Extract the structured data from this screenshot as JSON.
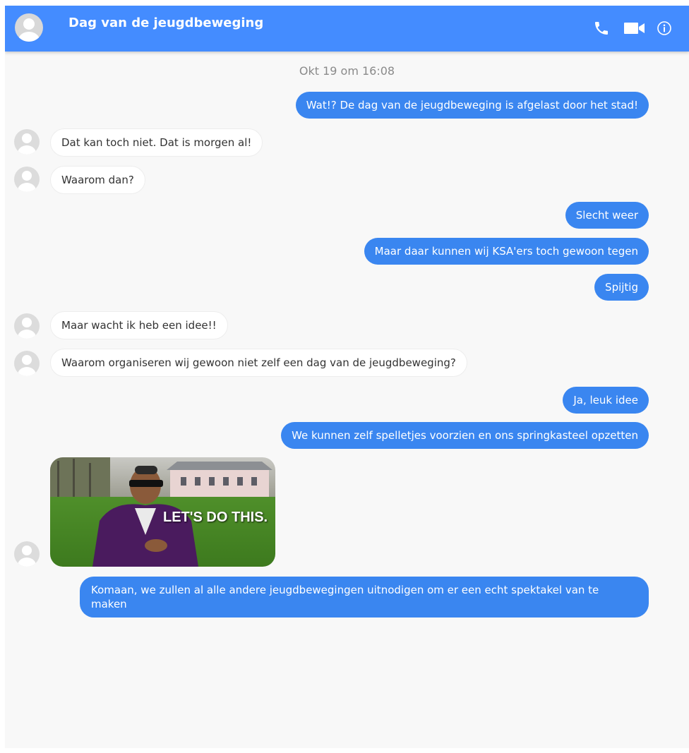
{
  "header": {
    "title": "Dag van de jeugdbeweging",
    "background_color": "#448cff",
    "icons": [
      "phone-icon",
      "video-camera-icon",
      "info-icon"
    ]
  },
  "thread": {
    "timestamp": "Okt 19 om 16:08",
    "messages": [
      {
        "direction": "outgoing",
        "text": "Wat!? De dag van de jeugdbeweging is afgelast door het stad!"
      },
      {
        "direction": "incoming",
        "text": "Dat kan toch niet. Dat is morgen al!"
      },
      {
        "direction": "incoming",
        "text": "Waarom dan?"
      },
      {
        "direction": "outgoing",
        "text": "Slecht weer"
      },
      {
        "direction": "outgoing",
        "text": "Maar daar kunnen wij KSA'ers toch gewoon tegen"
      },
      {
        "direction": "outgoing",
        "text": "Spijtig"
      },
      {
        "direction": "incoming",
        "text": "Maar wacht ik heb een idee!!"
      },
      {
        "direction": "incoming",
        "text": "Waarom organiseren wij gewoon niet zelf een dag van de jeugdbeweging?"
      },
      {
        "direction": "outgoing",
        "text": "Ja, leuk idee"
      },
      {
        "direction": "outgoing",
        "text": "We kunnen zelf spelletjes voorzien en ons springkasteel opzetten"
      },
      {
        "direction": "incoming",
        "type": "gif",
        "caption": "LET'S DO THIS."
      },
      {
        "direction": "outgoing",
        "text": "Komaan, we zullen al alle andere jeugdbewegingen uitnodigen om er een echt spektakel van te maken"
      }
    ]
  },
  "colors": {
    "outgoing_bubble": "#3a86f0",
    "incoming_bubble": "#ffffff",
    "background": "#f8f8f8"
  }
}
